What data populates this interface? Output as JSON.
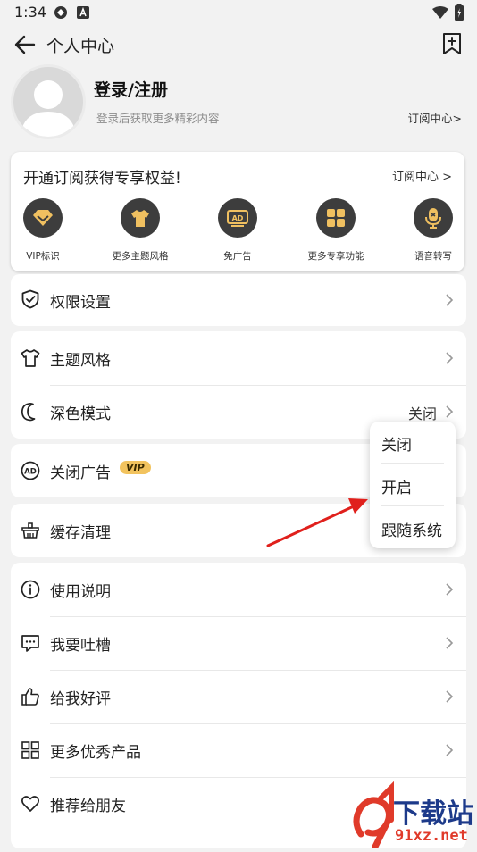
{
  "status_bar": {
    "time": "1:34"
  },
  "header": {
    "title": "个人中心"
  },
  "profile": {
    "login_title": "登录/注册",
    "login_subtitle": "登录后获取更多精彩内容",
    "subscription_link": "订阅中心>"
  },
  "subscription_card": {
    "title": "开通订阅获得专享权益!",
    "link": "订阅中心 >",
    "benefits": [
      {
        "label": "VIP标识",
        "icon": "vip-diamond-icon"
      },
      {
        "label": "更多主题风格",
        "icon": "shirt-icon"
      },
      {
        "label": "免广告",
        "icon": "ad-icon"
      },
      {
        "label": "更多专享功能",
        "icon": "grid-icon"
      },
      {
        "label": "语音转写",
        "icon": "microphone-icon"
      }
    ]
  },
  "menu": {
    "permissions": "权限设置",
    "theme": "主题风格",
    "dark_mode": "深色模式",
    "dark_mode_value": "关闭",
    "close_ads": "关闭广告",
    "vip_badge": "VIP",
    "cache_clear": "缓存清理",
    "instructions": "使用说明",
    "feedback": "我要吐槽",
    "rate": "给我好评",
    "more_products": "更多优秀产品",
    "recommend": "推荐给朋友"
  },
  "dropdown": {
    "options": [
      "关闭",
      "开启",
      "跟随系统"
    ]
  },
  "watermark": {
    "brand": "下载站",
    "domain": "91xz.net"
  },
  "colors": {
    "accent_dark": "#3d3d3d",
    "vip_gold": "#f2c35e",
    "arrow_red": "#e0201c"
  }
}
